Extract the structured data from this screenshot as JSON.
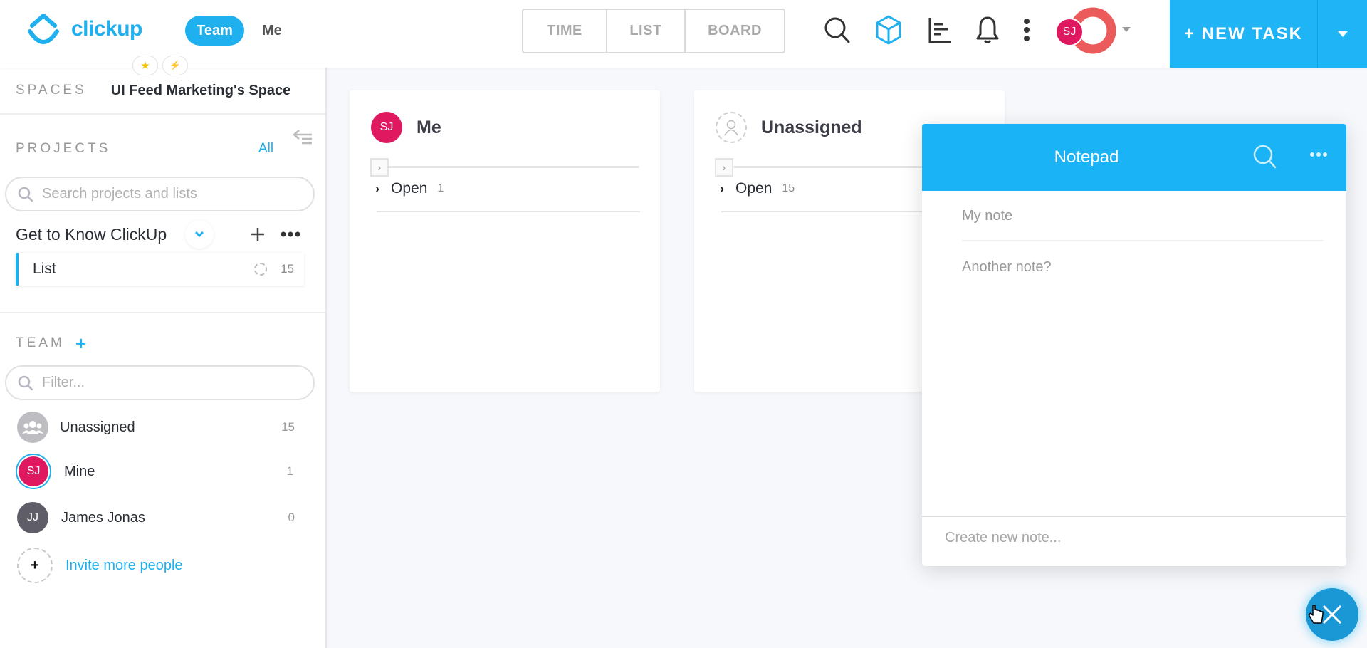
{
  "app": {
    "logo_text": "clickup",
    "brand_color": "#1fb0f0",
    "scope_tabs": [
      {
        "label": "Team",
        "active": true
      },
      {
        "label": "Me",
        "active": false
      }
    ],
    "quick_badges": [
      {
        "icon": "star-icon",
        "glyph": "★"
      },
      {
        "icon": "lightning-icon",
        "glyph": "⚡"
      }
    ]
  },
  "header": {
    "view_tabs": [
      {
        "label": "TIME"
      },
      {
        "label": "LIST"
      },
      {
        "label": "BOARD"
      }
    ],
    "icons": [
      "search-icon",
      "box-icon",
      "dashboard-icon",
      "bell-icon",
      "more-vertical-icon"
    ],
    "user_initials": "SJ",
    "new_task_label": "+ NEW TASK"
  },
  "sidebar": {
    "spaces_label": "SPACES",
    "space_name": "UI Feed Marketing's Space",
    "projects_label": "PROJECTS",
    "projects_all_label": "All",
    "search_placeholder": "Search projects and lists",
    "project": {
      "name": "Get to Know ClickUp",
      "lists": [
        {
          "name": "List",
          "count": "15"
        }
      ]
    },
    "team_label": "TEAM",
    "filter_placeholder": "Filter...",
    "members": [
      {
        "name": "Unassigned",
        "initials": "",
        "count": "15",
        "color": "#bdbdc2"
      },
      {
        "name": "Mine",
        "initials": "SJ",
        "count": "1",
        "color": "#e0185f"
      },
      {
        "name": "James Jonas",
        "initials": "JJ",
        "count": "0",
        "color": "#5f5d68"
      }
    ],
    "invite_label": "Invite more people",
    "invite_glyph": "+"
  },
  "board": {
    "columns": [
      {
        "title": "Me",
        "initials": "SJ",
        "status": "Open",
        "count": "1"
      },
      {
        "title": "Unassigned",
        "initials": "",
        "status": "Open",
        "count": "15"
      }
    ]
  },
  "notepad": {
    "title": "Notepad",
    "notes": [
      "My note",
      "Another note?"
    ],
    "new_note_placeholder": "Create new note...",
    "header_color": "#1ab4f6"
  }
}
